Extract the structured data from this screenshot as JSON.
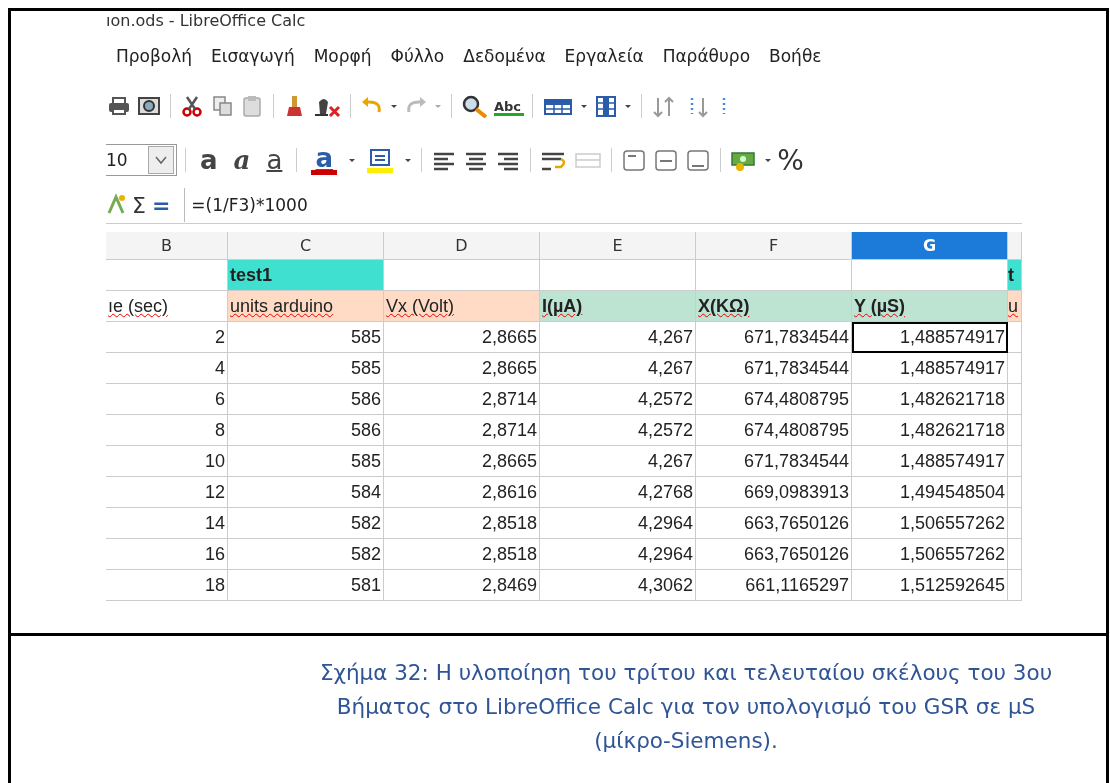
{
  "window": {
    "title": "ıon.ods - LibreOffice Calc"
  },
  "menu": [
    {
      "label": "Προβολή"
    },
    {
      "label": "Εισαγωγή"
    },
    {
      "label": "Μορφή"
    },
    {
      "label": "Φύλλο"
    },
    {
      "label": "Δεδομένα"
    },
    {
      "label": "Εργαλεία"
    },
    {
      "label": "Παράθυρο"
    },
    {
      "label": "Βοήθε"
    }
  ],
  "standard_toolbar": {
    "spellcheck_label": "Abc"
  },
  "format_toolbar": {
    "font_size": "10",
    "buttons": [
      {
        "kind": "bold",
        "label": "a"
      },
      {
        "kind": "italic",
        "label": "a"
      },
      {
        "kind": "underline",
        "label": "a"
      },
      {
        "kind": "font_color",
        "label": "a",
        "color": "#cc0000"
      },
      {
        "kind": "highlight",
        "color": "#ffee00"
      }
    ],
    "percent": "%"
  },
  "formula_bar": {
    "sum": "Σ",
    "equals": "=",
    "formula": "=(1/F3)*1000"
  },
  "sheet": {
    "columns": [
      {
        "label": "B",
        "selected": false
      },
      {
        "label": "C",
        "selected": false
      },
      {
        "label": "D",
        "selected": false
      },
      {
        "label": "E",
        "selected": false
      },
      {
        "label": "F",
        "selected": false
      },
      {
        "label": "G",
        "selected": true
      },
      {
        "selected": false
      }
    ],
    "rows": [
      [
        {},
        {
          "text": "test1",
          "color": "#40e0d0",
          "bold": true
        },
        {},
        {},
        {},
        {},
        {
          "text": "t",
          "color": "#40e0d0",
          "bold": true
        }
      ],
      [
        {
          "text": "ıe (sec)",
          "misspelled": true
        },
        {
          "text": "units arduino",
          "color": "#ffdbc5",
          "misspelled": true
        },
        {
          "text": "Vx (Volt)",
          "color": "#ffdbc5",
          "misspelled": true
        },
        {
          "text": "I(µA)",
          "color": "#bde3d2",
          "bold": true,
          "misspelled": true
        },
        {
          "text": "X(KΩ)",
          "color": "#bde3d2",
          "bold": true,
          "misspelled": true
        },
        {
          "text": "Y (µS)",
          "color": "#bde3d2",
          "bold": true,
          "misspelled": true
        },
        {
          "text": "u",
          "color": "#ffdbc5",
          "misspelled": true
        }
      ],
      [
        {
          "text": "2",
          "kind": "number"
        },
        {
          "text": "585",
          "kind": "number"
        },
        {
          "text": "2,8665",
          "kind": "number"
        },
        {
          "text": "4,267",
          "kind": "number"
        },
        {
          "text": "671,7834544",
          "kind": "number"
        },
        {
          "text": "1,488574917",
          "kind": "number",
          "selected": true
        },
        {}
      ],
      [
        {
          "text": "4",
          "kind": "number"
        },
        {
          "text": "585",
          "kind": "number"
        },
        {
          "text": "2,8665",
          "kind": "number"
        },
        {
          "text": "4,267",
          "kind": "number"
        },
        {
          "text": "671,7834544",
          "kind": "number"
        },
        {
          "text": "1,488574917",
          "kind": "number"
        },
        {}
      ],
      [
        {
          "text": "6",
          "kind": "number"
        },
        {
          "text": "586",
          "kind": "number"
        },
        {
          "text": "2,8714",
          "kind": "number"
        },
        {
          "text": "4,2572",
          "kind": "number"
        },
        {
          "text": "674,4808795",
          "kind": "number"
        },
        {
          "text": "1,482621718",
          "kind": "number"
        },
        {}
      ],
      [
        {
          "text": "8",
          "kind": "number"
        },
        {
          "text": "586",
          "kind": "number"
        },
        {
          "text": "2,8714",
          "kind": "number"
        },
        {
          "text": "4,2572",
          "kind": "number"
        },
        {
          "text": "674,4808795",
          "kind": "number"
        },
        {
          "text": "1,482621718",
          "kind": "number"
        },
        {}
      ],
      [
        {
          "text": "10",
          "kind": "number"
        },
        {
          "text": "585",
          "kind": "number"
        },
        {
          "text": "2,8665",
          "kind": "number"
        },
        {
          "text": "4,267",
          "kind": "number"
        },
        {
          "text": "671,7834544",
          "kind": "number"
        },
        {
          "text": "1,488574917",
          "kind": "number"
        },
        {}
      ],
      [
        {
          "text": "12",
          "kind": "number"
        },
        {
          "text": "584",
          "kind": "number"
        },
        {
          "text": "2,8616",
          "kind": "number"
        },
        {
          "text": "4,2768",
          "kind": "number"
        },
        {
          "text": "669,0983913",
          "kind": "number"
        },
        {
          "text": "1,494548504",
          "kind": "number"
        },
        {}
      ],
      [
        {
          "text": "14",
          "kind": "number"
        },
        {
          "text": "582",
          "kind": "number"
        },
        {
          "text": "2,8518",
          "kind": "number"
        },
        {
          "text": "4,2964",
          "kind": "number"
        },
        {
          "text": "663,7650126",
          "kind": "number"
        },
        {
          "text": "1,506557262",
          "kind": "number"
        },
        {}
      ],
      [
        {
          "text": "16",
          "kind": "number"
        },
        {
          "text": "582",
          "kind": "number"
        },
        {
          "text": "2,8518",
          "kind": "number"
        },
        {
          "text": "4,2964",
          "kind": "number"
        },
        {
          "text": "663,7650126",
          "kind": "number"
        },
        {
          "text": "1,506557262",
          "kind": "number"
        },
        {}
      ],
      [
        {
          "text": "18",
          "kind": "number"
        },
        {
          "text": "581",
          "kind": "number"
        },
        {
          "text": "2,8469",
          "kind": "number"
        },
        {
          "text": "4,3062",
          "kind": "number"
        },
        {
          "text": "661,1165297",
          "kind": "number"
        },
        {
          "text": "1,512592645",
          "kind": "number"
        },
        {}
      ]
    ]
  },
  "caption": "Σχήμα 32: Η υλοποίηση του τρίτου και τελευταίου σκέλους του 3ου Βήματος στο LibreOffice Calc για τον υπολογισμό του GSR σε μS (μίκρο-Siemens)."
}
